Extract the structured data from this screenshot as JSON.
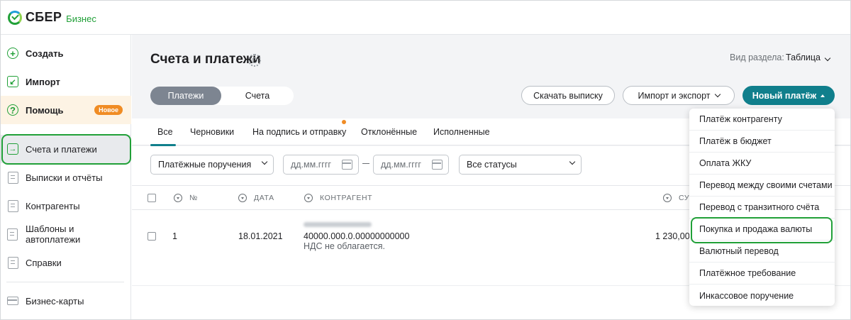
{
  "brand": {
    "name": "СБЕР",
    "sub": "Бизнес"
  },
  "sidebar": {
    "items": [
      {
        "label": "Создать",
        "icon": "plus-icon"
      },
      {
        "label": "Импорт",
        "icon": "import-icon"
      },
      {
        "label": "Помощь",
        "icon": "question-icon",
        "badge": "Новое"
      },
      {
        "label": "Счета и платежи",
        "icon": "accounts-icon"
      },
      {
        "label": "Выписки и отчёты",
        "icon": "statements-icon"
      },
      {
        "label": "Контрагенты",
        "icon": "counterparties-icon"
      },
      {
        "label": "Шаблоны и автоплатежи",
        "icon": "templates-icon"
      },
      {
        "label": "Справки",
        "icon": "certificates-icon"
      },
      {
        "label": "Бизнес-карты",
        "icon": "card-icon"
      }
    ]
  },
  "header": {
    "title": "Счета и платежи",
    "view_label": "Вид раздела:",
    "view_value": "Таблица"
  },
  "segment": {
    "active": "Платежи",
    "inactive": "Счета"
  },
  "actions": {
    "download": "Скачать выписку",
    "import_export": "Импорт и экспорт",
    "new_payment": "Новый платёж"
  },
  "tabs": [
    "Все",
    "Черновики",
    "На подпись и отправку",
    "Отклонённые",
    "Исполненные"
  ],
  "filters": {
    "doc_type": "Платёжные поручения",
    "date_from": "дд.мм.гггг",
    "date_to": "дд.мм.гггг",
    "status": "Все статусы"
  },
  "table": {
    "headers": {
      "num": "№",
      "date": "ДАТА",
      "counterparty": "КОНТРАГЕНТ",
      "sum": "СУ"
    },
    "rows": [
      {
        "num": "1",
        "date": "18.01.2021",
        "counterparty_account": "40000.000.0.00000000000",
        "counterparty_note": "НДС не облагается.",
        "sum": "1 230,00"
      }
    ]
  },
  "new_payment_menu": [
    "Платёж контрагенту",
    "Платёж в бюджет",
    "Оплата ЖКУ",
    "Перевод между своими счетами",
    "Перевод с транзитного счёта",
    "Покупка и продажа валюты",
    "Валютный перевод",
    "Платёжное требование",
    "Инкассовое поручение"
  ],
  "colors": {
    "brand_green": "#21a038",
    "accent_teal": "#107f8c",
    "badge_orange": "#f08c24"
  }
}
